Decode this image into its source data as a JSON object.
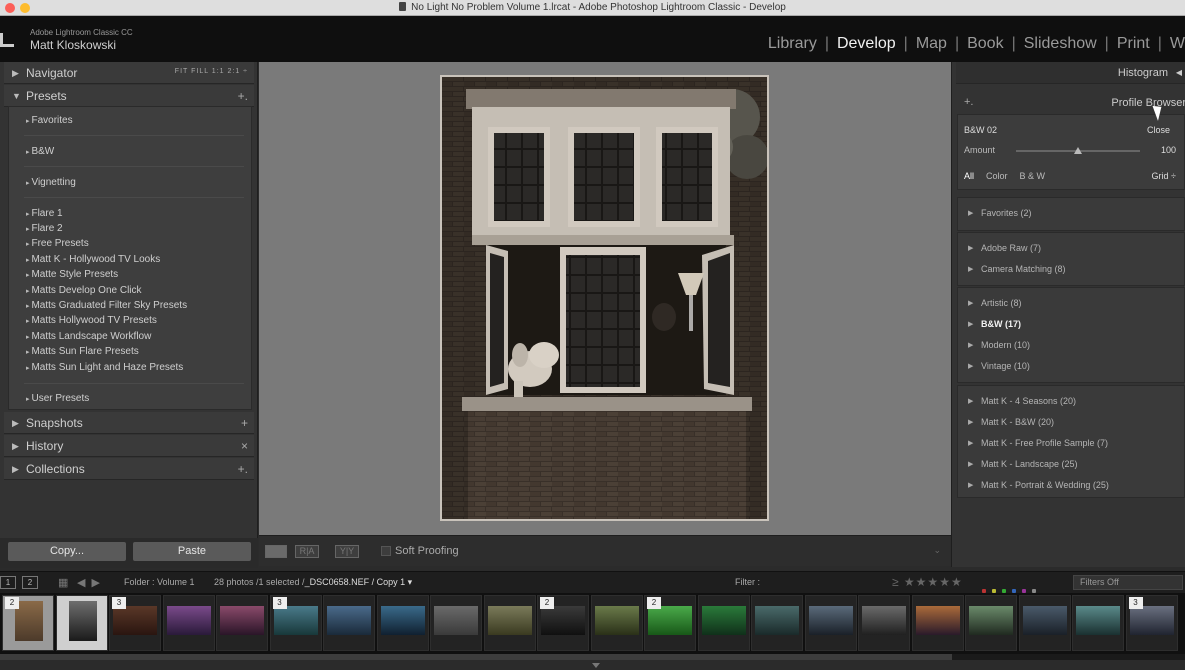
{
  "window": {
    "title": "No Light No Problem Volume 1.lrcat - Adobe Photoshop Lightroom Classic - Develop"
  },
  "identity": {
    "app": "Adobe Lightroom Classic CC",
    "user": "Matt Kloskowski"
  },
  "modules": [
    "Library",
    "Develop",
    "Map",
    "Book",
    "Slideshow",
    "Print",
    "W"
  ],
  "active_module": "Develop",
  "left_panel": {
    "navigator": {
      "label": "Navigator",
      "options": "FIT  FILL  1:1  2:1 ÷"
    },
    "presets": {
      "label": "Presets",
      "action": "+.",
      "items": [
        "Favorites",
        "B&W",
        "Vignetting",
        "Flare 1",
        "Flare 2",
        "Free Presets",
        "Matt K - Hollywood TV Looks",
        "Matte Style Presets",
        "Matts Develop One Click",
        "Matts Graduated Filter Sky Presets",
        "Matts Hollywood TV Presets",
        "Matts Landscape Workflow",
        "Matts Sun Flare Presets",
        "Matts Sun Light and Haze Presets",
        "User Presets"
      ]
    },
    "snapshots": {
      "label": "Snapshots",
      "action": "+"
    },
    "history": {
      "label": "History",
      "action": "×"
    },
    "collections": {
      "label": "Collections",
      "action": "+."
    },
    "copy_button": "Copy...",
    "paste_button": "Paste"
  },
  "toolbar": {
    "view_options": [
      "",
      "R|A",
      "Y|Y"
    ],
    "soft_proofing_label": "Soft Proofing"
  },
  "right_panel": {
    "histogram_label": "Histogram",
    "profile_browser_label": "Profile Browser",
    "profile_browser_action": "+.",
    "profile_name": "B&W 02",
    "close_label": "Close",
    "amount_label": "Amount",
    "amount_value": "100",
    "amount_fraction": 0.5,
    "filter_tabs": [
      "All",
      "Color",
      "B & W"
    ],
    "view_option": "Grid ÷",
    "groups": [
      [
        "Favorites (2)"
      ],
      [
        "Adobe Raw (7)",
        "Camera Matching (8)"
      ],
      [
        "Artistic (8)",
        "B&W (17)",
        "Modern (10)",
        "Vintage (10)"
      ],
      [
        "Matt K - 4 Seasons (20)",
        "Matt K - B&W (20)",
        "Matt K - Free Profile Sample (7)",
        "Matt K - Landscape (25)",
        "Matt K - Portrait & Wedding (25)"
      ]
    ],
    "selected_group_item": "B&W (17)"
  },
  "filmstrip_bar": {
    "monitor1": "1",
    "monitor2": "2",
    "folder": "Folder : Volume 1",
    "count_prefix": "28 photos /1 selected /",
    "filename": "_DSC0658.NEF / Copy 1 ▾",
    "filter_label": "Filter :",
    "stars": "≥ ★★★★★",
    "filters_off": "Filters Off"
  },
  "filmstrip": {
    "thumbnails": [
      {
        "badge": "2",
        "colors": [
          "#8a6a48",
          "#4c3a2a"
        ]
      },
      {
        "badge": "",
        "colors": [
          "#6e6e6e",
          "#1a1a1a"
        ]
      },
      {
        "badge": "3",
        "colors": [
          "#5a3828",
          "#2a1510"
        ]
      },
      {
        "badge": "",
        "colors": [
          "#7a4a8a",
          "#2a1a3a"
        ]
      },
      {
        "badge": "",
        "colors": [
          "#8a4a6a",
          "#2a1528"
        ]
      },
      {
        "badge": "3",
        "colors": [
          "#4a7a8a",
          "#18383a"
        ]
      },
      {
        "badge": "",
        "colors": [
          "#4a6a8a",
          "#1a2a3a"
        ]
      },
      {
        "badge": "",
        "colors": [
          "#3a6a8a",
          "#102030"
        ]
      },
      {
        "badge": "",
        "colors": [
          "#6a6a6a",
          "#3a3a3a"
        ]
      },
      {
        "badge": "",
        "colors": [
          "#7a7a5a",
          "#3a3a20"
        ]
      },
      {
        "badge": "2",
        "colors": [
          "#3a3a3a",
          "#101010"
        ]
      },
      {
        "badge": "",
        "colors": [
          "#6a7a4a",
          "#2a3018"
        ]
      },
      {
        "badge": "2",
        "colors": [
          "#4aaa4a",
          "#185818"
        ]
      },
      {
        "badge": "",
        "colors": [
          "#2a7a3a",
          "#10301a"
        ]
      },
      {
        "badge": "",
        "colors": [
          "#4a6a6a",
          "#1a2a2a"
        ]
      },
      {
        "badge": "",
        "colors": [
          "#5a6a7a",
          "#1a2028"
        ]
      },
      {
        "badge": "",
        "colors": [
          "#6a6a6a",
          "#202020"
        ]
      },
      {
        "badge": "",
        "colors": [
          "#aa6a3a",
          "#2a1a2a"
        ]
      },
      {
        "badge": "",
        "colors": [
          "#6a8a6a",
          "#202a20"
        ]
      },
      {
        "badge": "",
        "colors": [
          "#4a5a6a",
          "#1a2028"
        ]
      },
      {
        "badge": "",
        "colors": [
          "#5a8a8a",
          "#1a3030"
        ]
      },
      {
        "badge": "3",
        "colors": [
          "#6a7080",
          "#202430"
        ]
      }
    ]
  }
}
